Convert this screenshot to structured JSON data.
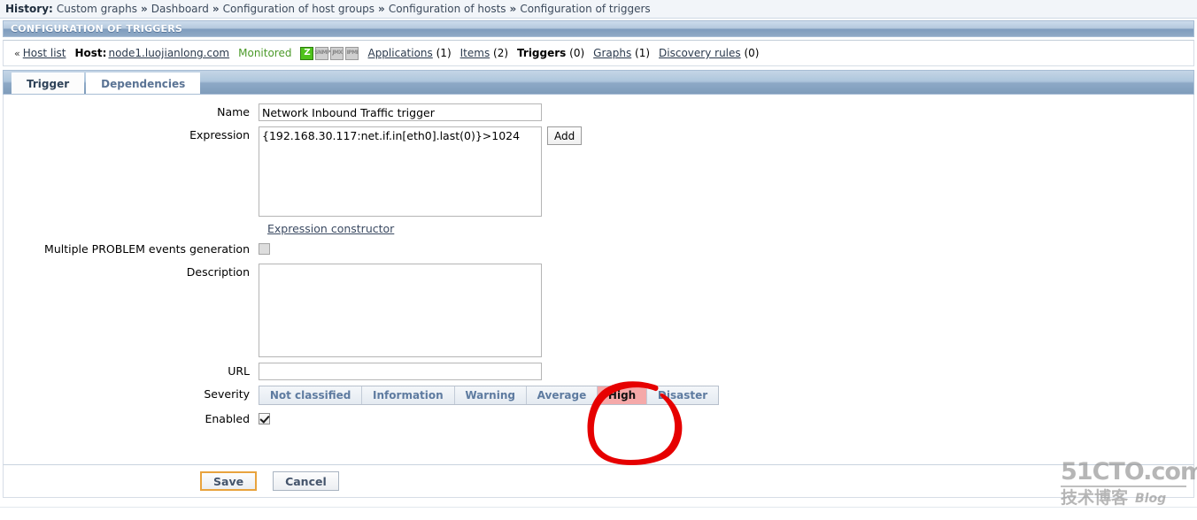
{
  "history": {
    "label": "History:",
    "separator": "»",
    "items": [
      {
        "label": "Custom graphs",
        "link": true
      },
      {
        "label": "Dashboard",
        "link": true
      },
      {
        "label": "Configuration of host groups",
        "link": true
      },
      {
        "label": "Configuration of hosts",
        "link": true
      },
      {
        "label": "Configuration of triggers",
        "link": true
      }
    ]
  },
  "page_header": {
    "title": "CONFIGURATION OF TRIGGERS"
  },
  "host_nav": {
    "chevron": "«",
    "host_list_link": "Host list",
    "host_label": "Host:",
    "host_name": "node1.luojianlong.com",
    "status": "Monitored",
    "availability_icons": [
      {
        "name": "zabbix-agent-availability-icon",
        "text": "Z",
        "state": "active"
      },
      {
        "name": "snmp-availability-icon",
        "text": "SNMP",
        "state": "inactive"
      },
      {
        "name": "jmx-availability-icon",
        "text": "JMX",
        "state": "inactive"
      },
      {
        "name": "ipmi-availability-icon",
        "text": "IPMI",
        "state": "inactive"
      }
    ],
    "links": [
      {
        "label": "Applications",
        "count": "(1)",
        "link": true
      },
      {
        "label": "Items",
        "count": "(2)",
        "link": true
      },
      {
        "label": "Triggers",
        "count": "(0)",
        "link": false
      },
      {
        "label": "Graphs",
        "count": "(1)",
        "link": true
      },
      {
        "label": "Discovery rules",
        "count": "(0)",
        "link": true
      }
    ]
  },
  "tabs": [
    {
      "label": "Trigger",
      "selected": true
    },
    {
      "label": "Dependencies",
      "selected": false
    }
  ],
  "form": {
    "name_label": "Name",
    "name_value": "Network Inbound Traffic trigger",
    "expression_label": "Expression",
    "expression_value": "{192.168.30.117:net.if.in[eth0].last(0)}>1024",
    "add_button": "Add",
    "expression_constructor_link": "Expression constructor",
    "multiple_problem_label": "Multiple PROBLEM events generation",
    "multiple_problem_checked": false,
    "description_label": "Description",
    "description_value": "",
    "url_label": "URL",
    "url_value": "",
    "severity_label": "Severity",
    "severity_options": [
      {
        "label": "Not classified",
        "selected": false
      },
      {
        "label": "Information",
        "selected": false
      },
      {
        "label": "Warning",
        "selected": false
      },
      {
        "label": "Average",
        "selected": false
      },
      {
        "label": "High",
        "selected": true
      },
      {
        "label": "Disaster",
        "selected": false
      }
    ],
    "enabled_label": "Enabled",
    "enabled_checked": true
  },
  "footer": {
    "save_label": "Save",
    "cancel_label": "Cancel"
  },
  "annotation": {
    "shape": "hand-drawn-red-circle",
    "color": "#e60000",
    "target": "High"
  },
  "watermark": {
    "top": "51CTO.com",
    "bottom_cn": "技术博客",
    "bottom_en": "Blog"
  }
}
